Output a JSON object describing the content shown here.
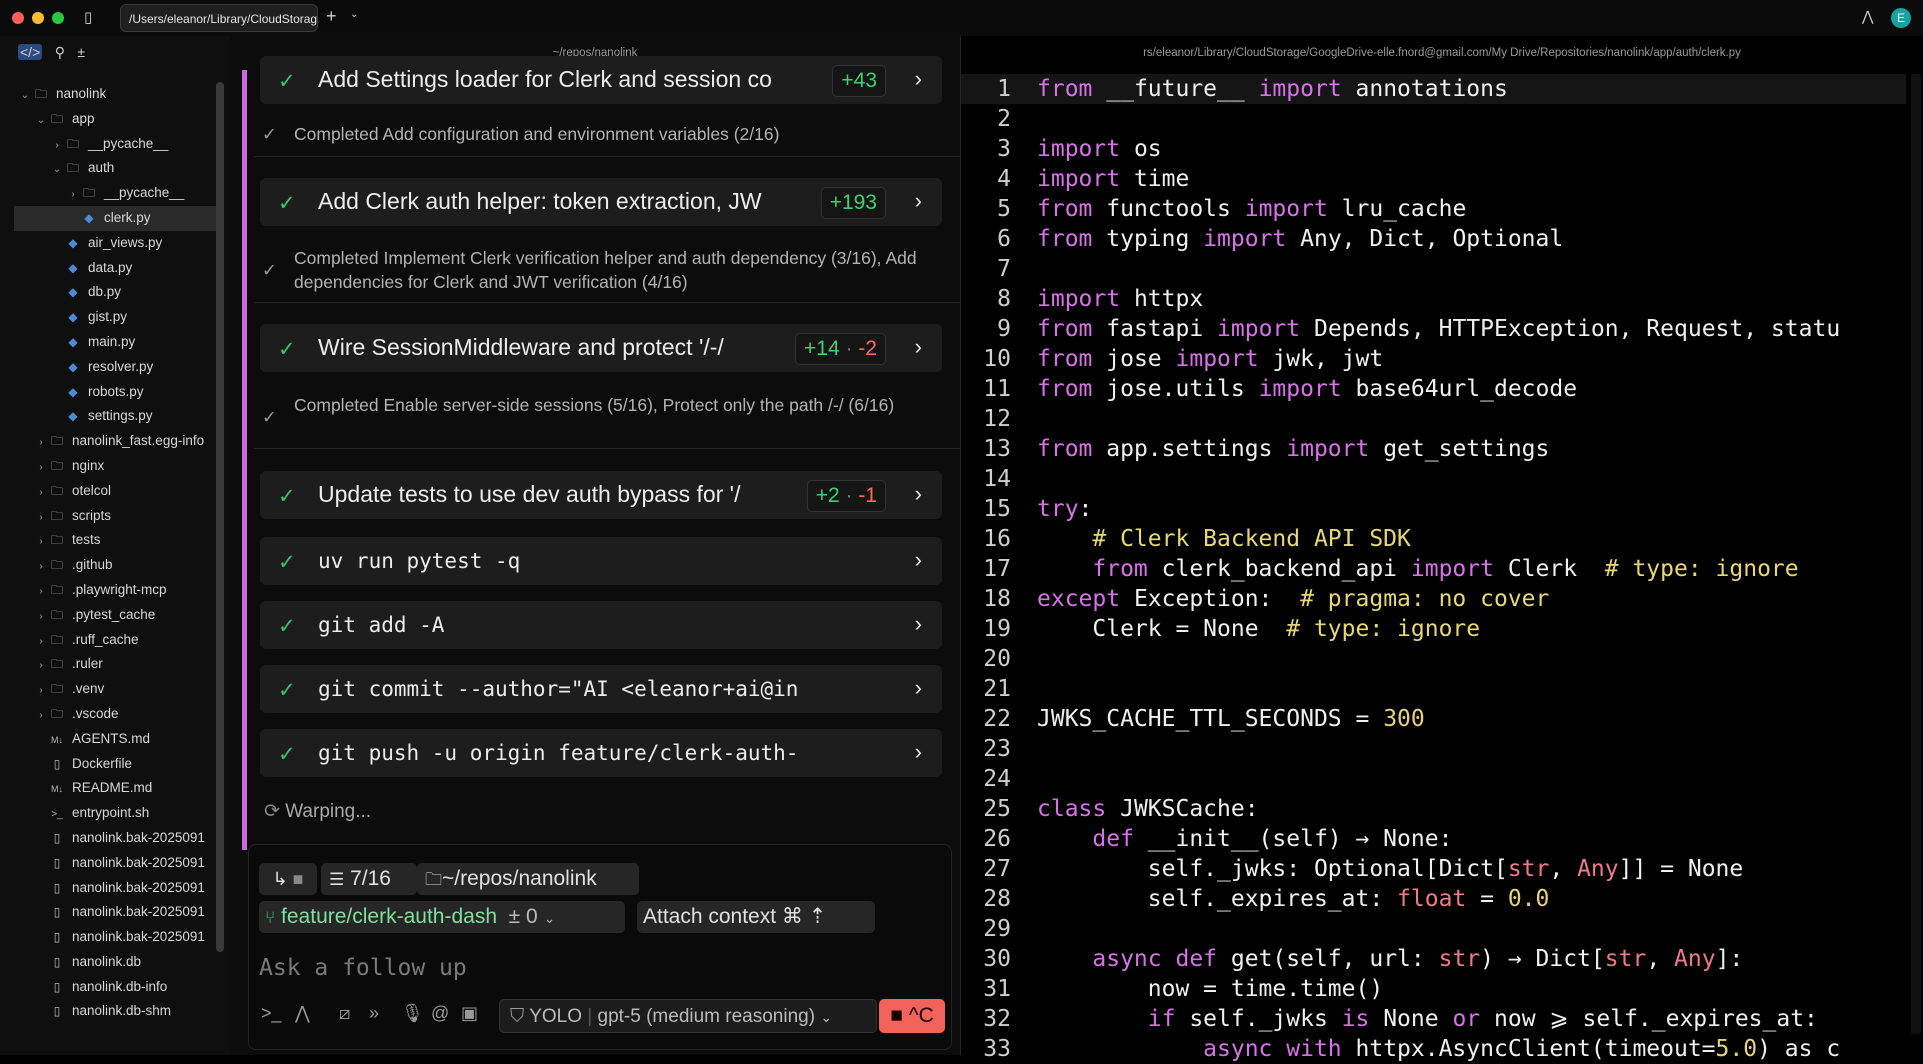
{
  "titlebar": {
    "tab_title": "/Users/eleanor/Library/CloudStorage",
    "avatar_letter": "E"
  },
  "sidebar": {
    "items": [
      {
        "label": "nanolink",
        "type": "folder",
        "depth": 0,
        "expanded": true
      },
      {
        "label": "app",
        "type": "folder",
        "depth": 1,
        "expanded": true
      },
      {
        "label": "__pycache__",
        "type": "folder",
        "depth": 2,
        "expanded": false
      },
      {
        "label": "auth",
        "type": "folder",
        "depth": 2,
        "expanded": true
      },
      {
        "label": "__pycache__",
        "type": "folder",
        "depth": 3,
        "expanded": false
      },
      {
        "label": "clerk.py",
        "type": "py",
        "depth": 3,
        "selected": true
      },
      {
        "label": "air_views.py",
        "type": "py",
        "depth": 2
      },
      {
        "label": "data.py",
        "type": "py",
        "depth": 2
      },
      {
        "label": "db.py",
        "type": "py",
        "depth": 2
      },
      {
        "label": "gist.py",
        "type": "py",
        "depth": 2
      },
      {
        "label": "main.py",
        "type": "py",
        "depth": 2
      },
      {
        "label": "resolver.py",
        "type": "py",
        "depth": 2
      },
      {
        "label": "robots.py",
        "type": "py",
        "depth": 2
      },
      {
        "label": "settings.py",
        "type": "py",
        "depth": 2
      },
      {
        "label": "nanolink_fast.egg-info",
        "type": "folder",
        "depth": 1,
        "expanded": false
      },
      {
        "label": "nginx",
        "type": "folder",
        "depth": 1,
        "expanded": false
      },
      {
        "label": "otelcol",
        "type": "folder",
        "depth": 1,
        "expanded": false
      },
      {
        "label": "scripts",
        "type": "folder",
        "depth": 1,
        "expanded": false
      },
      {
        "label": "tests",
        "type": "folder",
        "depth": 1,
        "expanded": false
      },
      {
        "label": ".github",
        "type": "folder",
        "depth": 1,
        "expanded": false
      },
      {
        "label": ".playwright-mcp",
        "type": "folder",
        "depth": 1,
        "expanded": false
      },
      {
        "label": ".pytest_cache",
        "type": "folder",
        "depth": 1,
        "expanded": false
      },
      {
        "label": ".ruff_cache",
        "type": "folder",
        "depth": 1,
        "expanded": false
      },
      {
        "label": ".ruler",
        "type": "folder",
        "depth": 1,
        "expanded": false
      },
      {
        "label": ".venv",
        "type": "folder",
        "depth": 1,
        "expanded": false
      },
      {
        "label": ".vscode",
        "type": "folder",
        "depth": 1,
        "expanded": false
      },
      {
        "label": "AGENTS.md",
        "type": "md",
        "depth": 1
      },
      {
        "label": "Dockerfile",
        "type": "file",
        "depth": 1
      },
      {
        "label": "README.md",
        "type": "md",
        "depth": 1
      },
      {
        "label": "entrypoint.sh",
        "type": "sh",
        "depth": 1
      },
      {
        "label": "nanolink.bak-2025091",
        "type": "file",
        "depth": 1
      },
      {
        "label": "nanolink.bak-2025091",
        "type": "file",
        "depth": 1
      },
      {
        "label": "nanolink.bak-2025091",
        "type": "file",
        "depth": 1
      },
      {
        "label": "nanolink.bak-2025091",
        "type": "file",
        "depth": 1
      },
      {
        "label": "nanolink.bak-2025091",
        "type": "file",
        "depth": 1
      },
      {
        "label": "nanolink.db",
        "type": "file",
        "depth": 1
      },
      {
        "label": "nanolink.db-info",
        "type": "file",
        "depth": 1
      },
      {
        "label": "nanolink.db-shm",
        "type": "file",
        "depth": 1
      }
    ]
  },
  "center": {
    "path": "~/repos/nanolink",
    "cards": [
      {
        "title": "Add Settings loader for Clerk and session co",
        "mono": false,
        "add": "+43",
        "del": ""
      },
      {
        "title": "Add Clerk auth helper: token extraction, JW",
        "mono": false,
        "add": "+193",
        "del": ""
      },
      {
        "title": "Wire SessionMiddleware and protect '/-/",
        "mono": false,
        "add": "+14",
        "del": "-2"
      },
      {
        "title": "Update tests to use dev auth bypass for '/",
        "mono": false,
        "add": "+2",
        "del": "-1"
      },
      {
        "title": "uv run pytest -q",
        "mono": true,
        "add": "",
        "del": ""
      },
      {
        "title": "git add -A",
        "mono": true,
        "add": "",
        "del": ""
      },
      {
        "title": "git commit --author=\"AI <eleanor+ai@in",
        "mono": true,
        "add": "",
        "del": ""
      },
      {
        "title": "git push -u origin feature/clerk-auth-",
        "mono": true,
        "add": "",
        "del": ""
      }
    ],
    "notes": [
      "Completed Add configuration and environment variables (2/16)",
      "Completed Implement Clerk verification helper and auth dependency (3/16), Add dependencies for Clerk and JWT verification (4/16)",
      "Completed Enable server-side sessions (5/16), Protect only the path /-/ (6/16)"
    ],
    "status": "Warping...",
    "input": {
      "task_count": "7/16",
      "cwd": "~/repos/nanolink",
      "branch": "feature/clerk-auth-dash",
      "diff_count": "± 0",
      "attach": "Attach context ⌘ ⇡",
      "placeholder": "Ask a follow up",
      "mode": "YOLO",
      "model": "gpt-5 (medium reasoning)",
      "stop": "^C"
    }
  },
  "editor": {
    "path": "rs/eleanor/Library/CloudStorage/GoogleDrive-elle.fnord@gmail.com/My Drive/Repositories/nanolink/app/auth/clerk.py",
    "lines": [
      [
        [
          "kw",
          "from "
        ],
        [
          "tx",
          "__future__ "
        ],
        [
          "kw",
          "import "
        ],
        [
          "tx",
          "annotations"
        ]
      ],
      [],
      [
        [
          "kw",
          "import "
        ],
        [
          "tx",
          "os"
        ]
      ],
      [
        [
          "kw",
          "import "
        ],
        [
          "tx",
          "time"
        ]
      ],
      [
        [
          "kw",
          "from "
        ],
        [
          "tx",
          "functools "
        ],
        [
          "kw",
          "import "
        ],
        [
          "tx",
          "lru_cache"
        ]
      ],
      [
        [
          "kw",
          "from "
        ],
        [
          "tx",
          "typing "
        ],
        [
          "kw",
          "import "
        ],
        [
          "tx",
          "Any, Dict, Optional"
        ]
      ],
      [],
      [
        [
          "kw",
          "import "
        ],
        [
          "tx",
          "httpx"
        ]
      ],
      [
        [
          "kw",
          "from "
        ],
        [
          "tx",
          "fastapi "
        ],
        [
          "kw",
          "import "
        ],
        [
          "tx",
          "Depends, HTTPException, Request, statu"
        ]
      ],
      [
        [
          "kw",
          "from "
        ],
        [
          "tx",
          "jose "
        ],
        [
          "kw",
          "import "
        ],
        [
          "tx",
          "jwk, jwt"
        ]
      ],
      [
        [
          "kw",
          "from "
        ],
        [
          "tx",
          "jose.utils "
        ],
        [
          "kw",
          "import "
        ],
        [
          "tx",
          "base64url_decode"
        ]
      ],
      [],
      [
        [
          "kw",
          "from "
        ],
        [
          "tx",
          "app.settings "
        ],
        [
          "kw",
          "import "
        ],
        [
          "tx",
          "get_settings"
        ]
      ],
      [],
      [
        [
          "kw",
          "try"
        ],
        [
          "tx",
          ":"
        ]
      ],
      [
        [
          "cm",
          "    # Clerk Backend API SDK"
        ]
      ],
      [
        [
          "kw",
          "    from "
        ],
        [
          "tx",
          "clerk_backend_api "
        ],
        [
          "kw",
          "import "
        ],
        [
          "tx",
          "Clerk  "
        ],
        [
          "cm",
          "# type: ignore"
        ]
      ],
      [
        [
          "kw",
          "except "
        ],
        [
          "tx",
          "Exception:  "
        ],
        [
          "cm",
          "# pragma: no cover"
        ]
      ],
      [
        [
          "tx",
          "    Clerk = None  "
        ],
        [
          "cm",
          "# type: ignore"
        ]
      ],
      [],
      [],
      [
        [
          "tx",
          "JWKS_CACHE_TTL_SECONDS = "
        ],
        [
          "num",
          "300"
        ]
      ],
      [],
      [],
      [
        [
          "kw",
          "class "
        ],
        [
          "tx",
          "JWKSCache:"
        ]
      ],
      [
        [
          "kw",
          "    def "
        ],
        [
          "tx",
          "__init__(self) → None:"
        ]
      ],
      [
        [
          "tx",
          "        self._jwks: Optional[Dict["
        ],
        [
          "tp",
          "str"
        ],
        [
          "tx",
          ", "
        ],
        [
          "tp",
          "Any"
        ],
        [
          "tx",
          "]] = None"
        ]
      ],
      [
        [
          "tx",
          "        self._expires_at: "
        ],
        [
          "tp",
          "float"
        ],
        [
          "tx",
          " = "
        ],
        [
          "num",
          "0.0"
        ]
      ],
      [],
      [
        [
          "kw",
          "    async def "
        ],
        [
          "tx",
          "get(self, url: "
        ],
        [
          "tp",
          "str"
        ],
        [
          "tx",
          ") → Dict["
        ],
        [
          "tp",
          "str"
        ],
        [
          "tx",
          ", "
        ],
        [
          "tp",
          "Any"
        ],
        [
          "tx",
          "]:"
        ]
      ],
      [
        [
          "tx",
          "        now = time.time()"
        ]
      ],
      [
        [
          "kw",
          "        if "
        ],
        [
          "tx",
          "self._jwks "
        ],
        [
          "kw",
          "is "
        ],
        [
          "tx",
          "None "
        ],
        [
          "kw",
          "or "
        ],
        [
          "tx",
          "now ⩾ self._expires_at:"
        ]
      ],
      [
        [
          "kw",
          "            async with "
        ],
        [
          "tx",
          "httpx.AsyncClient(timeout="
        ],
        [
          "num",
          "5.0"
        ],
        [
          "tx",
          ") as c"
        ]
      ]
    ]
  }
}
